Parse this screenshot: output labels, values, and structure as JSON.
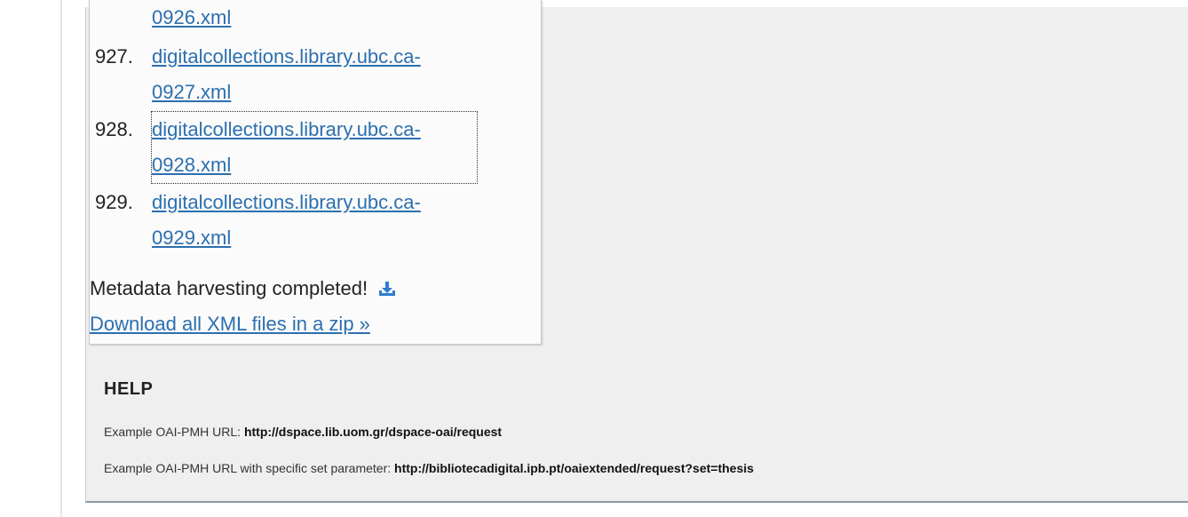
{
  "files": [
    {
      "number": "",
      "name_line1": "",
      "name_line2": "0926.xml"
    },
    {
      "number": "927.",
      "name_line1": "digitalcollections.library.ubc.ca-",
      "name_line2": "0927.xml"
    },
    {
      "number": "928.",
      "name_line1": "digitalcollections.library.ubc.ca-",
      "name_line2": "0928.xml"
    },
    {
      "number": "929.",
      "name_line1": "digitalcollections.library.ubc.ca-",
      "name_line2": "0929.xml"
    }
  ],
  "status": {
    "text": "Metadata harvesting completed!",
    "icon": "download-icon",
    "zip_link": "Download all XML files in a zip »"
  },
  "help": {
    "title": "HELP",
    "example1_label": "Example OAI-PMH URL: ",
    "example1_url": "http://dspace.lib.uom.gr/dspace-oai/request",
    "example2_label": "Example OAI-PMH URL with specific set parameter: ",
    "example2_url": "http://bibliotecadigital.ipb.pt/oaiextended/request?set=thesis"
  },
  "colors": {
    "link": "#2c6fb0",
    "icon": "#2f7bd0",
    "panel_bg": "#efefef"
  }
}
